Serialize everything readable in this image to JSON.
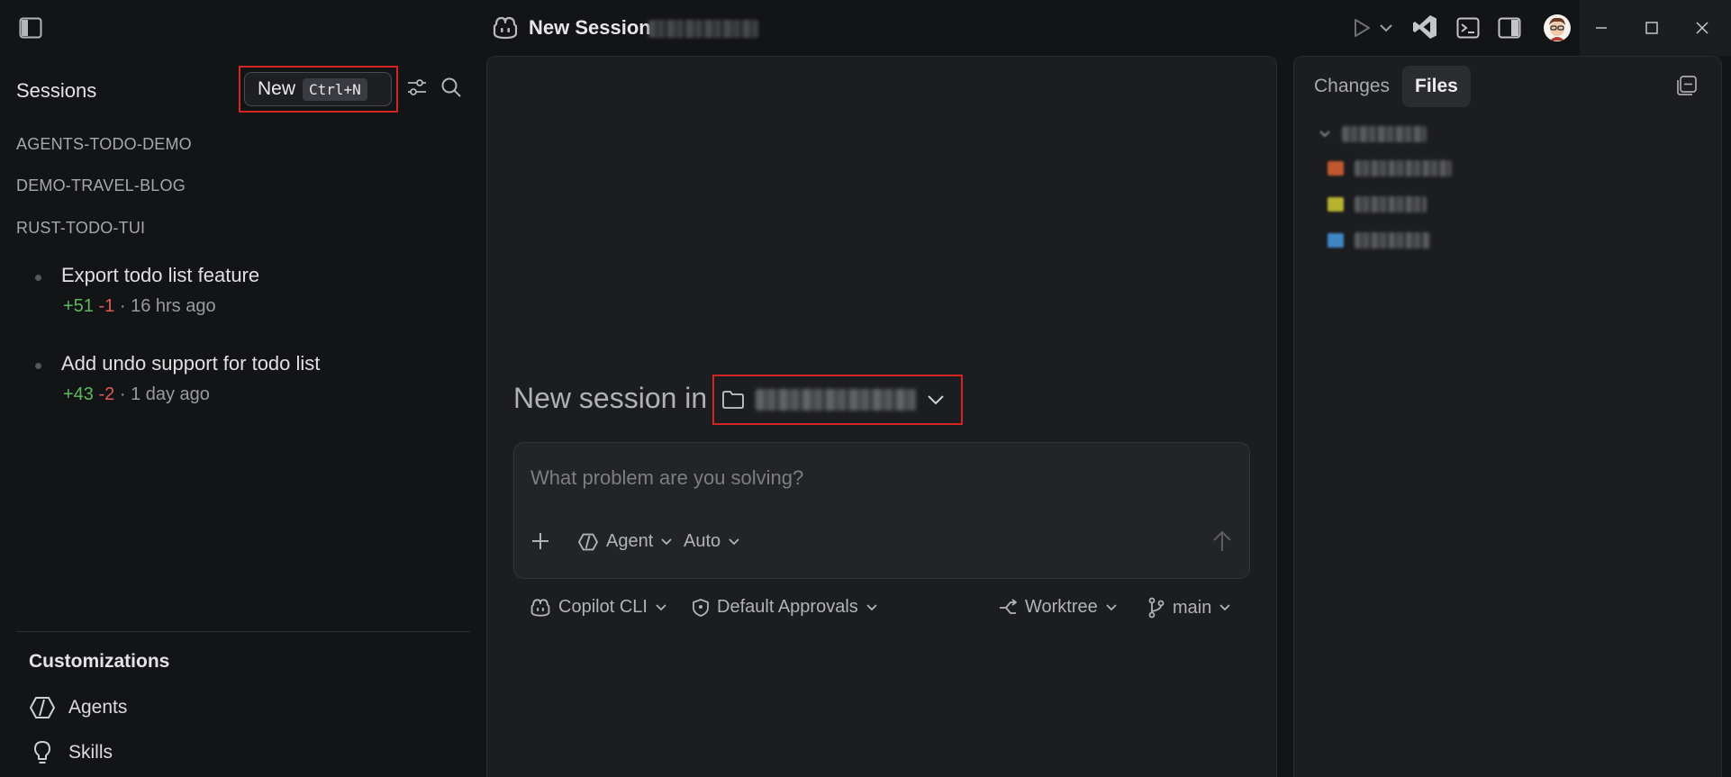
{
  "titlebar": {
    "session_title": "New Session",
    "session_repo_blurred": "agents-todo"
  },
  "sidebar": {
    "title": "Sessions",
    "new_button": {
      "label": "New",
      "shortcut": "Ctrl+N"
    },
    "groups": [
      "AGENTS-TODO-DEMO",
      "DEMO-TRAVEL-BLOG",
      "RUST-TODO-TUI"
    ],
    "sessions": [
      {
        "title": "Export todo list feature",
        "adds": "+51",
        "dels": "-1",
        "sep": " · ",
        "time": "16 hrs ago"
      },
      {
        "title": "Add undo support for todo list",
        "adds": "+43",
        "dels": "-2",
        "sep": " · ",
        "time": "1 day ago"
      }
    ],
    "customizations": {
      "title": "Customizations",
      "items": [
        {
          "label": "Agents",
          "icon": "agent-icon"
        },
        {
          "label": "Skills",
          "icon": "lightbulb-icon"
        }
      ]
    }
  },
  "center": {
    "heading": "New session in",
    "folder_blurred": "agents-todo",
    "prompt_placeholder": "What problem are you solving?",
    "prompt_tools": {
      "mode": "Agent",
      "model": "Auto"
    },
    "sub_tools": {
      "cli": "Copilot CLI",
      "approvals": "Default Approvals",
      "worktree": "Worktree",
      "branch": "main"
    }
  },
  "right": {
    "tabs": [
      "Changes",
      "Files"
    ],
    "active_tab": "Files",
    "tree": {
      "root_blurred": "agents-todo",
      "files_blurred": [
        "index.html",
        "script.js",
        "style.css"
      ]
    }
  },
  "colors": {
    "background": "#131416",
    "panel": "#1c1d20",
    "highlight": "#d62323",
    "additions": "#5fb85f",
    "deletions": "#e05a5a"
  }
}
